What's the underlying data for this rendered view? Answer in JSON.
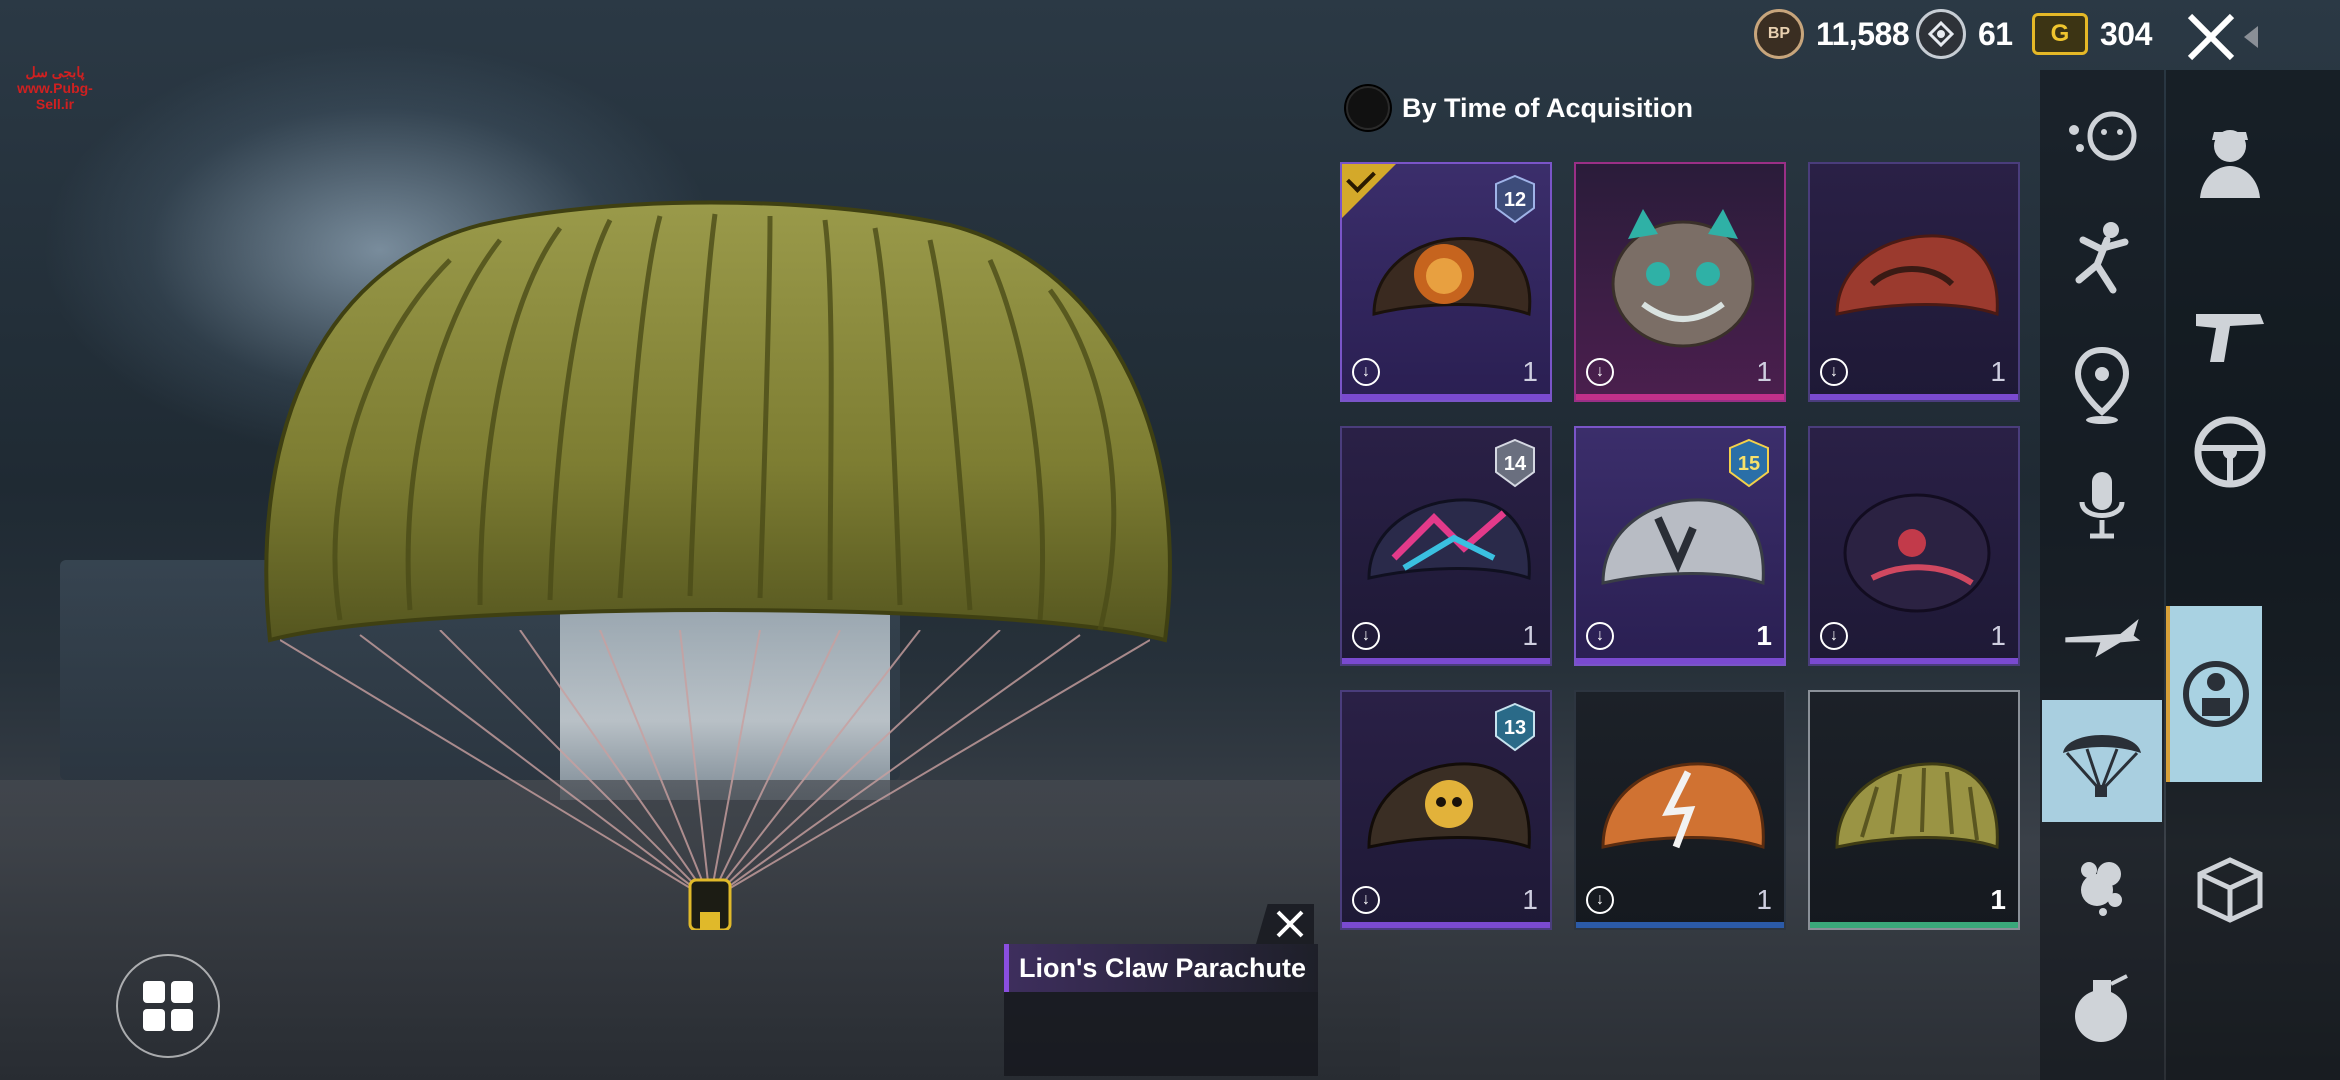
{
  "watermark": {
    "line1": "پابجی سل",
    "line2": "www.Pubg-Sell.ir"
  },
  "currency": {
    "bp": {
      "icon": "bp-coin-icon",
      "label": "BP",
      "value": "11,588"
    },
    "ag": {
      "icon": "silver-ag-icon",
      "value": "61"
    },
    "uc": {
      "icon": "gold-g-icon",
      "label": "G",
      "value": "304"
    }
  },
  "sort": {
    "label": "By Time of Acquisition"
  },
  "items": [
    {
      "name": "lion-parachute",
      "badge": "12",
      "qty": "1",
      "equipped": true,
      "rarity": "purple"
    },
    {
      "name": "cat-bag-parachute",
      "badge": "",
      "qty": "1",
      "rarity": "pink"
    },
    {
      "name": "red-camo-parachute",
      "badge": "",
      "qty": "1",
      "rarity": "purple"
    },
    {
      "name": "neon-parachute",
      "badge": "14",
      "qty": "1",
      "rarity": "purple"
    },
    {
      "name": "silver-rocket-parachute",
      "badge": "15",
      "qty": "1",
      "rarity": "purple",
      "selected": true
    },
    {
      "name": "purple-koi-parachute",
      "badge": "",
      "qty": "1",
      "rarity": "purple"
    },
    {
      "name": "skull-parachute",
      "badge": "13",
      "qty": "1",
      "rarity": "purple"
    },
    {
      "name": "orange-bolt-parachute",
      "badge": "",
      "qty": "1",
      "rarity": "blue"
    },
    {
      "name": "olive-parachute",
      "badge": "",
      "qty": "1",
      "rarity": "green",
      "selected": true
    }
  ],
  "selected_item": {
    "name": "Lion's Claw Parachute"
  },
  "colors": {
    "accent_purple": "#7a4ad0",
    "pink": "#c2308a",
    "blue": "#2b5aa8",
    "green": "#3aa87a",
    "gold": "#d4a92a",
    "active_tab": "#a9cfe0"
  }
}
